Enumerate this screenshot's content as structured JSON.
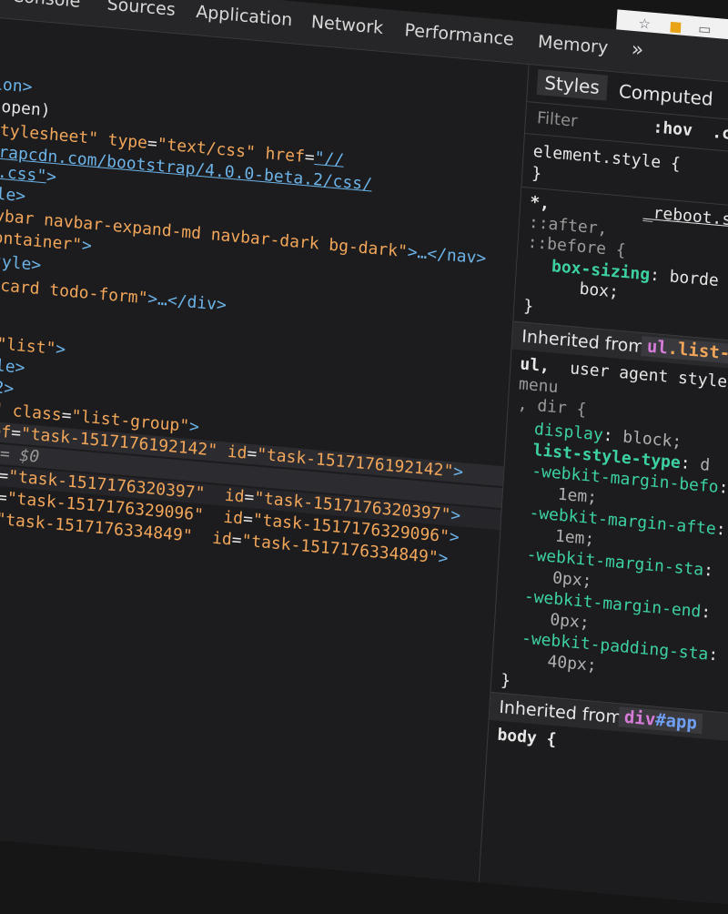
{
  "tabs": [
    "Console",
    "Sources",
    "Application",
    "Network",
    "Performance",
    "Memory"
  ],
  "tabs_more": "»",
  "browser_icons": [
    "star-icon",
    "lock-icon",
    "cast-icon",
    "shield-icon"
  ],
  "elements": {
    "lines": [
      {
        "parts": [
          [
            "t",
            "ion>"
          ]
        ]
      },
      {
        "parts": [
          [
            "i",
            "(open)"
          ]
        ]
      },
      {
        "parts": [
          [
            "a",
            "stylesheet\""
          ],
          [
            "i",
            " "
          ],
          [
            "a",
            "type"
          ],
          [
            "i",
            "="
          ],
          [
            "v",
            "\"text/css\""
          ],
          [
            "i",
            " "
          ],
          [
            "a",
            "href"
          ],
          [
            "i",
            "="
          ],
          [
            "tu",
            "\"//"
          ]
        ]
      },
      {
        "parts": [
          [
            "tu",
            "trapcdn.com/bootstrap/4.0.0-beta.2/css/"
          ]
        ]
      },
      {
        "parts": [
          [
            "tu",
            "n.css\""
          ],
          [
            "t",
            ">"
          ]
        ]
      },
      {
        "parts": [
          [
            "t",
            "yle>"
          ]
        ]
      },
      {
        "parts": [
          [
            "v",
            "avbar navbar-expand-md navbar-dark bg-dark\""
          ],
          [
            "t",
            ">…</nav>"
          ]
        ]
      },
      {
        "parts": [
          [
            "v",
            "container\""
          ],
          [
            "t",
            ">"
          ]
        ]
      },
      {
        "parts": [
          [
            "t",
            "style>"
          ]
        ]
      },
      {
        "parts": [
          [
            "i",
            "="
          ],
          [
            "v",
            "\"card todo-form\""
          ],
          [
            "t",
            ">…</div>"
          ]
        ]
      },
      {
        "parts": [
          [
            "a",
            "f"
          ],
          [
            "i",
            "="
          ],
          [
            "v",
            "\"list\""
          ],
          [
            "t",
            ">"
          ]
        ]
      },
      {
        "parts": [
          [
            "t",
            "tyle>"
          ]
        ]
      },
      {
        "parts": [
          [
            "t",
            "/h2>"
          ]
        ]
      },
      {
        "parts": [
          [
            "v",
            "os\""
          ],
          [
            "i",
            " "
          ],
          [
            "a",
            "class"
          ],
          [
            "i",
            "="
          ],
          [
            "v",
            "\"list-group\""
          ],
          [
            "t",
            ">"
          ]
        ]
      },
      {
        "parts": [
          [
            "a",
            " ref"
          ],
          [
            "i",
            "="
          ],
          [
            "v",
            "\"task-1517176192142\""
          ],
          [
            "i",
            " "
          ],
          [
            "a",
            "id"
          ],
          [
            "i",
            "="
          ],
          [
            "v",
            "\"task-1517176192142\""
          ],
          [
            "t",
            ">"
          ]
        ]
      },
      {
        "parts": [
          [
            "t",
            "> "
          ],
          [
            "d",
            "== $0"
          ]
        ]
      },
      {
        "parts": [
          [
            "a",
            "ref"
          ],
          [
            "i",
            "="
          ],
          [
            "v",
            "\"task-1517176320397\""
          ],
          [
            "i",
            "  "
          ],
          [
            "a",
            "id"
          ],
          [
            "i",
            "="
          ],
          [
            "v",
            "\"task-1517176320397\""
          ],
          [
            "t",
            ">"
          ]
        ]
      },
      {
        "parts": [
          [
            "a",
            "ref"
          ],
          [
            "i",
            "="
          ],
          [
            "v",
            "\"task-1517176329096\""
          ],
          [
            "i",
            "  "
          ],
          [
            "a",
            "id"
          ],
          [
            "i",
            "="
          ],
          [
            "v",
            "\"task-1517176329096\""
          ],
          [
            "t",
            ">"
          ]
        ]
      },
      {
        "parts": [
          [
            "a",
            "ef"
          ],
          [
            "i",
            "="
          ],
          [
            "v",
            "\"task-1517176334849\""
          ],
          [
            "i",
            "  "
          ],
          [
            "a",
            "id"
          ],
          [
            "i",
            "="
          ],
          [
            "v",
            "\"task-1517176334849\""
          ],
          [
            "t",
            ">"
          ]
        ]
      }
    ]
  },
  "styles_panel": {
    "tabs": [
      "Styles",
      "Computed"
    ],
    "filter_placeholder": "Filter",
    "hov": ":hov",
    "cls": ".c",
    "element_style": [
      "element.style {",
      "}"
    ],
    "reboot_rule": {
      "selector_lines": [
        "*,",
        "::after,",
        "::before {"
      ],
      "source": "_reboot.s",
      "declarations": [
        [
          "box-sizing",
          "borde"
        ],
        [
          "",
          "box;"
        ]
      ],
      "close": "}"
    },
    "inherited_1": {
      "label": "Inherited from",
      "tag": "ul",
      "cls": ".list-"
    },
    "ua_rule": {
      "selector_lines": [
        "ul,",
        "menu",
        ", dir {"
      ],
      "source": "user agent style",
      "declarations": [
        [
          "display",
          "block;"
        ],
        [
          "list-style-type",
          "d"
        ],
        [
          "-webkit-margin-befo",
          ""
        ],
        [
          "",
          "1em;"
        ],
        [
          "-webkit-margin-afte",
          ""
        ],
        [
          "",
          "1em;"
        ],
        [
          "-webkit-margin-sta",
          ""
        ],
        [
          "",
          "0px;"
        ],
        [
          "-webkit-margin-end",
          ""
        ],
        [
          "",
          "0px;"
        ],
        [
          "-webkit-padding-sta",
          ""
        ],
        [
          "",
          "40px;"
        ]
      ],
      "close": "}"
    },
    "inherited_2": {
      "label": "Inherited from",
      "tag": "div",
      "id": "#app"
    },
    "body_rule": "body {"
  }
}
